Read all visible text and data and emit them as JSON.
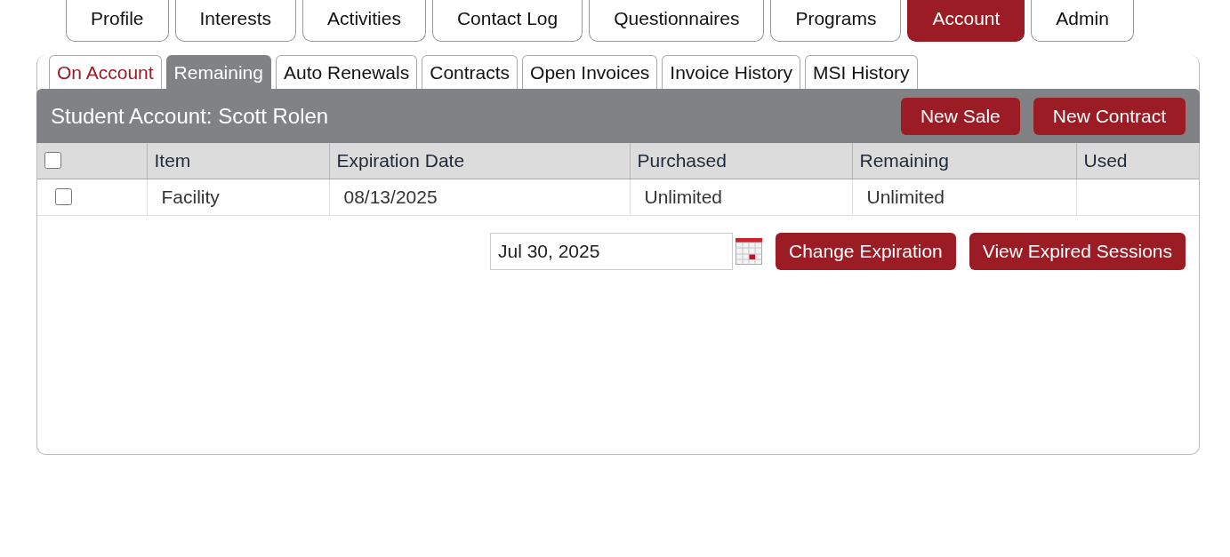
{
  "top_tabs": [
    {
      "label": "Profile",
      "selected": false
    },
    {
      "label": "Interests",
      "selected": false
    },
    {
      "label": "Activities",
      "selected": false
    },
    {
      "label": "Contact Log",
      "selected": false
    },
    {
      "label": "Questionnaires",
      "selected": false
    },
    {
      "label": "Programs",
      "selected": false
    },
    {
      "label": "Account",
      "selected": true
    },
    {
      "label": "Admin",
      "selected": false
    }
  ],
  "sub_tabs": [
    {
      "label": "On Account",
      "selected": false,
      "hovered": true
    },
    {
      "label": "Remaining",
      "selected": true,
      "hovered": false
    },
    {
      "label": "Auto Renewals",
      "selected": false,
      "hovered": false
    },
    {
      "label": "Contracts",
      "selected": false,
      "hovered": false
    },
    {
      "label": "Open Invoices",
      "selected": false,
      "hovered": false
    },
    {
      "label": "Invoice History",
      "selected": false,
      "hovered": false
    },
    {
      "label": "MSI History",
      "selected": false,
      "hovered": false
    }
  ],
  "account_header": {
    "title": "Student Account: Scott Rolen",
    "buttons": [
      "New Sale",
      "New Contract"
    ]
  },
  "table": {
    "select_all_checked": false,
    "columns": [
      "Item",
      "Expiration Date",
      "Purchased",
      "Remaining",
      "Used"
    ],
    "rows": [
      {
        "checked": false,
        "cells": [
          "Facility",
          "08/13/2025",
          "Unlimited",
          "Unlimited"
        ]
      }
    ]
  },
  "expiration": {
    "date_value": "Jul 30, 2025",
    "buttons": [
      "Change Expiration",
      "View Expired Sessions"
    ]
  }
}
